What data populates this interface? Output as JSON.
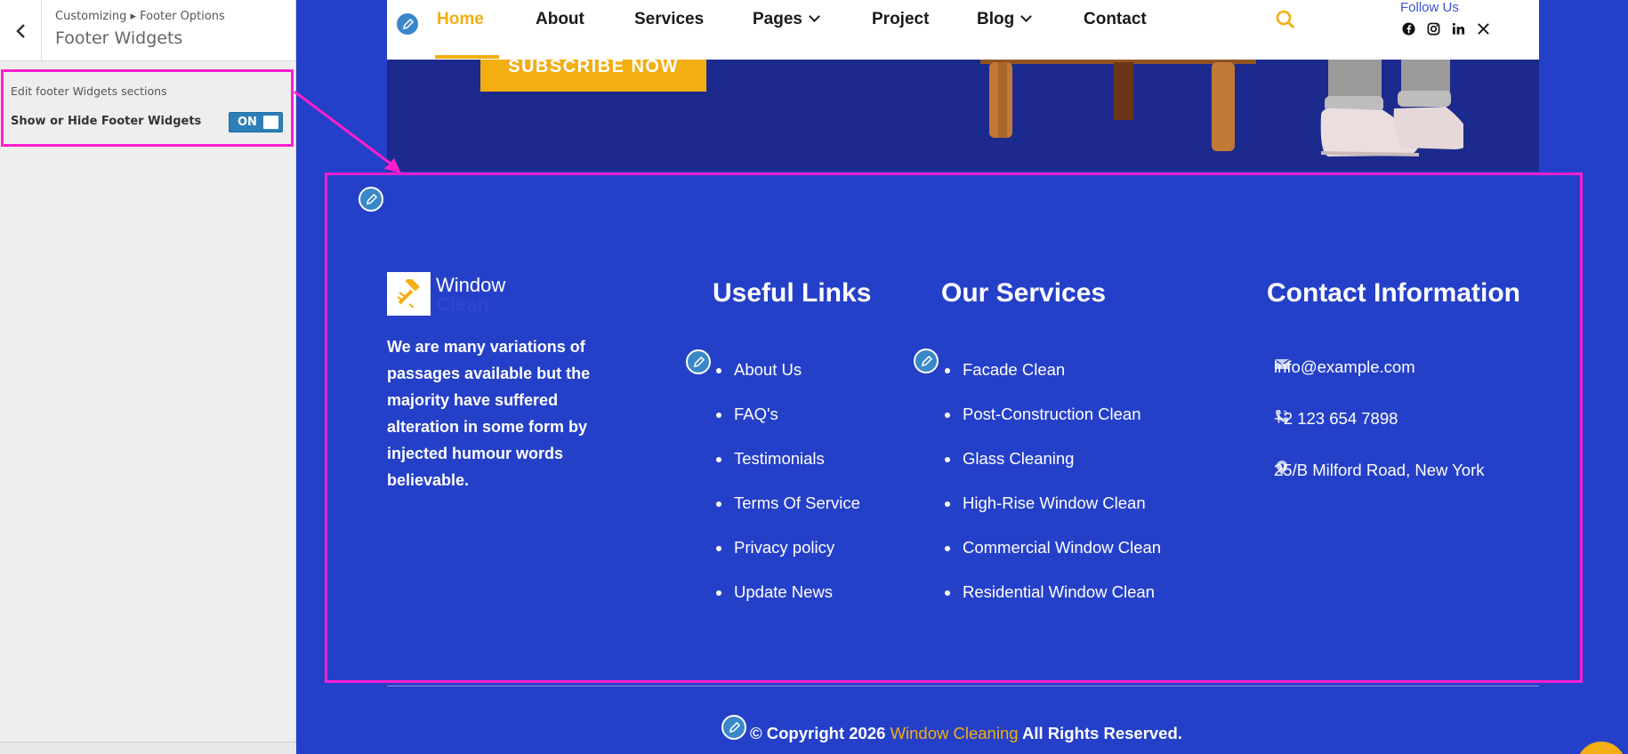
{
  "sidebar": {
    "breadcrumb": "Customizing ▸ Footer Options",
    "title": "Footer Widgets",
    "section_label": "Edit footer Widgets sections",
    "toggle_label": "Show or Hide Footer Widgets",
    "toggle_state": "ON"
  },
  "hero": {
    "subscribe_label": "SUBSCRIBE NOW"
  },
  "nav": {
    "items": [
      {
        "label": "Home",
        "active": true
      },
      {
        "label": "About"
      },
      {
        "label": "Services"
      },
      {
        "label": "Pages",
        "dropdown": true
      },
      {
        "label": "Project"
      },
      {
        "label": "Blog",
        "dropdown": true
      },
      {
        "label": "Contact"
      }
    ],
    "follow_label": "Follow Us",
    "social_icons": [
      "facebook-icon",
      "instagram-icon",
      "linkedin-icon",
      "x-icon"
    ]
  },
  "footer": {
    "logo_title": "Window",
    "logo_subtitle": "Clean",
    "about_text": "We are many variations of passages available but the majority have suffered alteration in some form by injected humour words believable.",
    "useful_links": {
      "title": "Useful Links",
      "items": [
        "About Us",
        "FAQ's",
        "Testimonials",
        "Terms Of Service",
        "Privacy policy",
        "Update News"
      ]
    },
    "services": {
      "title": "Our Services",
      "items": [
        "Facade Clean",
        "Post-Construction Clean",
        "Glass Cleaning",
        "High-Rise Window Clean",
        "Commercial Window Clean",
        "Residential Window Clean"
      ]
    },
    "contact": {
      "title": "Contact Information",
      "email": "info@example.com",
      "phone": "+2 123 654 7898",
      "address": "25/B Milford Road, New York"
    },
    "copyright_prefix": "© Copyright 2026",
    "copyright_brand": "Window Cleaning",
    "copyright_suffix": "All Rights Reserved."
  },
  "colors": {
    "accent": "#f3ae12",
    "footer_bg": "#2540c8",
    "highlight": "#ff1ecf",
    "toggle_on": "#2e7fb7"
  }
}
